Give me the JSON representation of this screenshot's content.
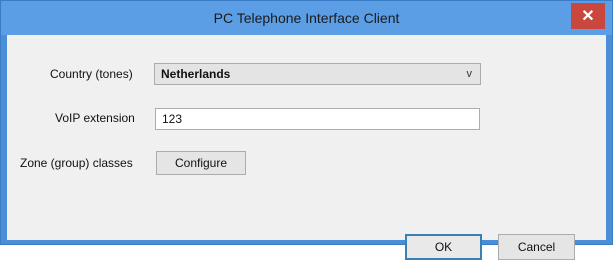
{
  "window": {
    "title": "PC Telephone Interface Client",
    "close_glyph": "✕"
  },
  "form": {
    "country_label": "Country (tones)",
    "country_value": "Netherlands",
    "country_chevron": "v",
    "voip_label": "VoIP extension",
    "voip_value": "123",
    "zone_label": "Zone (group) classes",
    "configure_label": "Configure"
  },
  "buttons": {
    "ok_label": "OK",
    "cancel_label": "Cancel"
  }
}
